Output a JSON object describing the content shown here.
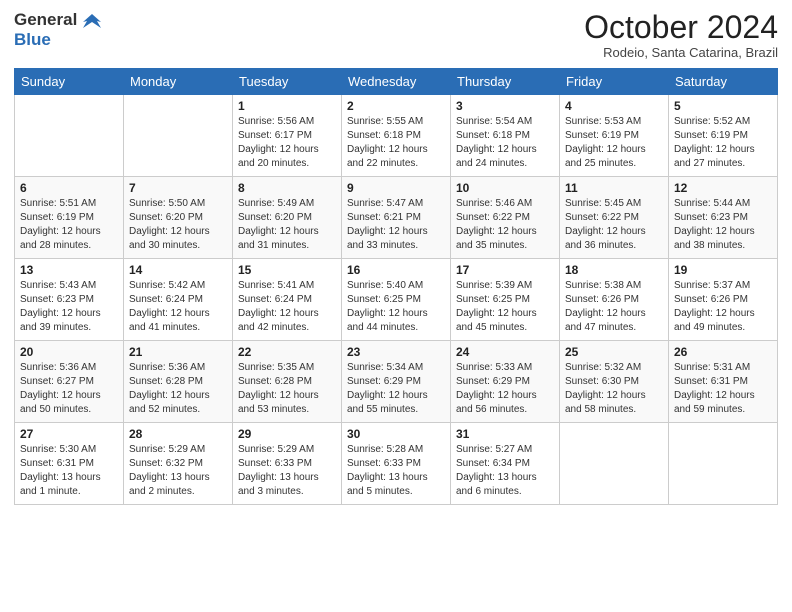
{
  "header": {
    "logo_general": "General",
    "logo_blue": "Blue",
    "month_year": "October 2024",
    "location": "Rodeio, Santa Catarina, Brazil"
  },
  "days_of_week": [
    "Sunday",
    "Monday",
    "Tuesday",
    "Wednesday",
    "Thursday",
    "Friday",
    "Saturday"
  ],
  "weeks": [
    [
      {
        "day": "",
        "info": ""
      },
      {
        "day": "",
        "info": ""
      },
      {
        "day": "1",
        "info": "Sunrise: 5:56 AM\nSunset: 6:17 PM\nDaylight: 12 hours and 20 minutes."
      },
      {
        "day": "2",
        "info": "Sunrise: 5:55 AM\nSunset: 6:18 PM\nDaylight: 12 hours and 22 minutes."
      },
      {
        "day": "3",
        "info": "Sunrise: 5:54 AM\nSunset: 6:18 PM\nDaylight: 12 hours and 24 minutes."
      },
      {
        "day": "4",
        "info": "Sunrise: 5:53 AM\nSunset: 6:19 PM\nDaylight: 12 hours and 25 minutes."
      },
      {
        "day": "5",
        "info": "Sunrise: 5:52 AM\nSunset: 6:19 PM\nDaylight: 12 hours and 27 minutes."
      }
    ],
    [
      {
        "day": "6",
        "info": "Sunrise: 5:51 AM\nSunset: 6:19 PM\nDaylight: 12 hours and 28 minutes."
      },
      {
        "day": "7",
        "info": "Sunrise: 5:50 AM\nSunset: 6:20 PM\nDaylight: 12 hours and 30 minutes."
      },
      {
        "day": "8",
        "info": "Sunrise: 5:49 AM\nSunset: 6:20 PM\nDaylight: 12 hours and 31 minutes."
      },
      {
        "day": "9",
        "info": "Sunrise: 5:47 AM\nSunset: 6:21 PM\nDaylight: 12 hours and 33 minutes."
      },
      {
        "day": "10",
        "info": "Sunrise: 5:46 AM\nSunset: 6:22 PM\nDaylight: 12 hours and 35 minutes."
      },
      {
        "day": "11",
        "info": "Sunrise: 5:45 AM\nSunset: 6:22 PM\nDaylight: 12 hours and 36 minutes."
      },
      {
        "day": "12",
        "info": "Sunrise: 5:44 AM\nSunset: 6:23 PM\nDaylight: 12 hours and 38 minutes."
      }
    ],
    [
      {
        "day": "13",
        "info": "Sunrise: 5:43 AM\nSunset: 6:23 PM\nDaylight: 12 hours and 39 minutes."
      },
      {
        "day": "14",
        "info": "Sunrise: 5:42 AM\nSunset: 6:24 PM\nDaylight: 12 hours and 41 minutes."
      },
      {
        "day": "15",
        "info": "Sunrise: 5:41 AM\nSunset: 6:24 PM\nDaylight: 12 hours and 42 minutes."
      },
      {
        "day": "16",
        "info": "Sunrise: 5:40 AM\nSunset: 6:25 PM\nDaylight: 12 hours and 44 minutes."
      },
      {
        "day": "17",
        "info": "Sunrise: 5:39 AM\nSunset: 6:25 PM\nDaylight: 12 hours and 45 minutes."
      },
      {
        "day": "18",
        "info": "Sunrise: 5:38 AM\nSunset: 6:26 PM\nDaylight: 12 hours and 47 minutes."
      },
      {
        "day": "19",
        "info": "Sunrise: 5:37 AM\nSunset: 6:26 PM\nDaylight: 12 hours and 49 minutes."
      }
    ],
    [
      {
        "day": "20",
        "info": "Sunrise: 5:36 AM\nSunset: 6:27 PM\nDaylight: 12 hours and 50 minutes."
      },
      {
        "day": "21",
        "info": "Sunrise: 5:36 AM\nSunset: 6:28 PM\nDaylight: 12 hours and 52 minutes."
      },
      {
        "day": "22",
        "info": "Sunrise: 5:35 AM\nSunset: 6:28 PM\nDaylight: 12 hours and 53 minutes."
      },
      {
        "day": "23",
        "info": "Sunrise: 5:34 AM\nSunset: 6:29 PM\nDaylight: 12 hours and 55 minutes."
      },
      {
        "day": "24",
        "info": "Sunrise: 5:33 AM\nSunset: 6:29 PM\nDaylight: 12 hours and 56 minutes."
      },
      {
        "day": "25",
        "info": "Sunrise: 5:32 AM\nSunset: 6:30 PM\nDaylight: 12 hours and 58 minutes."
      },
      {
        "day": "26",
        "info": "Sunrise: 5:31 AM\nSunset: 6:31 PM\nDaylight: 12 hours and 59 minutes."
      }
    ],
    [
      {
        "day": "27",
        "info": "Sunrise: 5:30 AM\nSunset: 6:31 PM\nDaylight: 13 hours and 1 minute."
      },
      {
        "day": "28",
        "info": "Sunrise: 5:29 AM\nSunset: 6:32 PM\nDaylight: 13 hours and 2 minutes."
      },
      {
        "day": "29",
        "info": "Sunrise: 5:29 AM\nSunset: 6:33 PM\nDaylight: 13 hours and 3 minutes."
      },
      {
        "day": "30",
        "info": "Sunrise: 5:28 AM\nSunset: 6:33 PM\nDaylight: 13 hours and 5 minutes."
      },
      {
        "day": "31",
        "info": "Sunrise: 5:27 AM\nSunset: 6:34 PM\nDaylight: 13 hours and 6 minutes."
      },
      {
        "day": "",
        "info": ""
      },
      {
        "day": "",
        "info": ""
      }
    ]
  ]
}
